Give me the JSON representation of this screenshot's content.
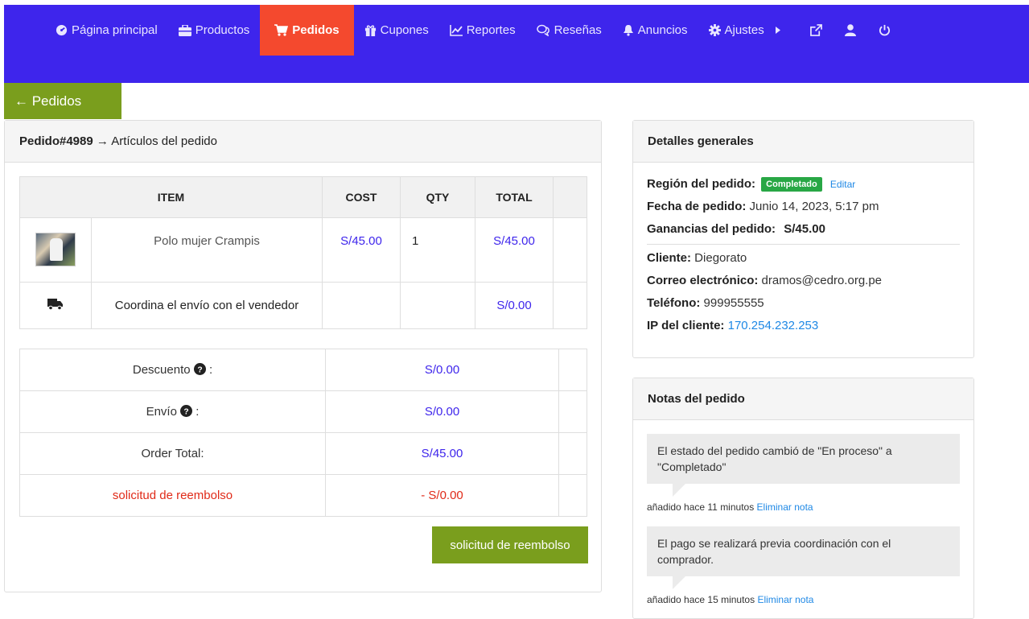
{
  "nav": [
    {
      "label": "Página principal",
      "icon": "dashboard-icon",
      "active": false
    },
    {
      "label": "Productos",
      "icon": "briefcase-icon",
      "active": false
    },
    {
      "label": "Pedidos",
      "icon": "cart-icon",
      "active": true
    },
    {
      "label": "Cupones",
      "icon": "gift-icon",
      "active": false
    },
    {
      "label": "Reportes",
      "icon": "chart-line-icon",
      "active": false
    },
    {
      "label": "Reseñas",
      "icon": "comments-icon",
      "active": false
    },
    {
      "label": "Anuncios",
      "icon": "bell-icon",
      "active": false
    },
    {
      "label": "Ajustes",
      "icon": "gear-icon",
      "active": false
    }
  ],
  "back_label": "← Pedidos",
  "order": {
    "number": "Pedido#4989",
    "subtitle": " → Artículos del pedido",
    "headers": {
      "item": "ITEM",
      "cost": "COST",
      "qty": "QTY",
      "total": "TOTAL"
    },
    "product": {
      "name": "Polo mujer Crampis",
      "cost": "S/45.00",
      "qty": "1",
      "total": "S/45.00"
    },
    "shipping": {
      "name": "Coordina el envío con el vendedor",
      "total": "S/0.00"
    },
    "totals": {
      "discount_label": "Descuento",
      "discount_value": "S/0.00",
      "shipping_label": "Envío",
      "shipping_value": "S/0.00",
      "order_total_label": "Order Total:",
      "order_total_value": "S/45.00",
      "refund_label": "solicitud de reembolso",
      "refund_value": "- S/0.00"
    },
    "refund_button": "solicitud de reembolso"
  },
  "details": {
    "title": "Detalles generales",
    "region_label": "Región del pedido:",
    "status": "Completado",
    "edit": "Editar",
    "date_label": "Fecha de pedido:",
    "date_value": " Junio 14, 2023, 5:17 pm",
    "earnings_label": "Ganancias del pedido:",
    "earnings_value": "S/45.00",
    "client_label": "Cliente:",
    "client_value": " Diegorato",
    "email_label": "Correo electrónico:",
    "email_value": " dramos@cedro.org.pe",
    "phone_label": "Teléfono:",
    "phone_value": " 999955555",
    "ip_label": "IP del cliente:",
    "ip_value": "170.254.232.253"
  },
  "notes": {
    "title": "Notas del pedido",
    "items": [
      {
        "text": "El estado del pedido cambió de \"En proceso\" a \"Completado\"",
        "meta": "añadido hace 11 minutos ",
        "delete": "Eliminar nota"
      },
      {
        "text": "El pago se realizará previa coordinación con el comprador.",
        "meta": "añadido hace 15 minutos ",
        "delete": "Eliminar nota"
      }
    ]
  },
  "colors": {
    "nav_bg": "#3e25ec",
    "active_tab": "#f4492e",
    "green": "#7a9e1d",
    "status_badge": "#28a745"
  }
}
